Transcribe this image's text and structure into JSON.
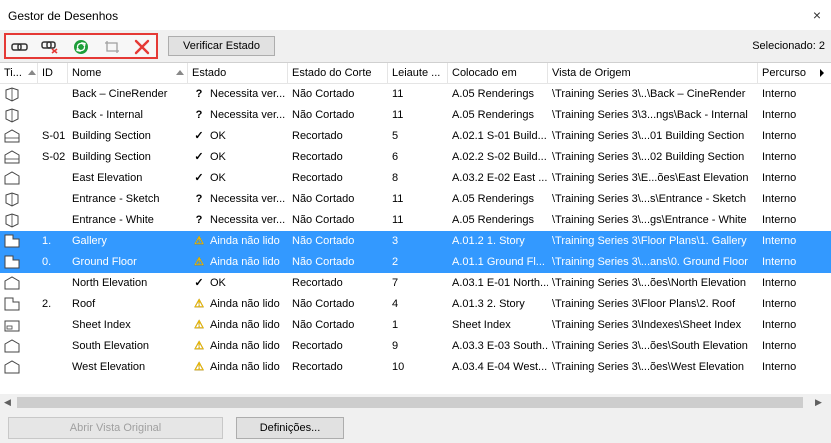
{
  "window": {
    "title": "Gestor de Desenhos",
    "close_glyph": "×"
  },
  "toolbar": {
    "verify_label": "Verificar Estado",
    "selected_label": "Selecionado: 2"
  },
  "columns": {
    "type": "Ti...",
    "id": "ID",
    "name": "Nome",
    "status": "Estado",
    "cut_state": "Estado do Corte",
    "layout": "Leiaute ...",
    "placed_in": "Colocado em",
    "source_view": "Vista de Origem",
    "path": "Percurso"
  },
  "rows": [
    {
      "icon": "shield-drawing-icon",
      "id": "",
      "name": "Back – CineRender",
      "status_icon": "?",
      "status": "Necessita ver...",
      "cut": "Não Cortado",
      "layout": "11",
      "placed": "A.05 Renderings",
      "source": "\\Training Series 3\\..\\Back – CineRender",
      "path": "Interno",
      "selected": false
    },
    {
      "icon": "shield-drawing-icon",
      "id": "",
      "name": "Back - Internal",
      "status_icon": "?",
      "status": "Necessita ver...",
      "cut": "Não Cortado",
      "layout": "11",
      "placed": "A.05 Renderings",
      "source": "\\Training Series 3\\3...ngs\\Back - Internal",
      "path": "Interno",
      "selected": false
    },
    {
      "icon": "section-drawing-icon",
      "id": "S-01",
      "name": "Building Section",
      "status_icon": "✓",
      "status": "OK",
      "cut": "Recortado",
      "layout": "5",
      "placed": "A.02.1 S-01 Build...",
      "source": "\\Training Series 3\\...01 Building Section",
      "path": "Interno",
      "selected": false
    },
    {
      "icon": "section-drawing-icon",
      "id": "S-02",
      "name": "Building Section",
      "status_icon": "✓",
      "status": "OK",
      "cut": "Recortado",
      "layout": "6",
      "placed": "A.02.2 S-02 Build...",
      "source": "\\Training Series 3\\...02 Building Section",
      "path": "Interno",
      "selected": false
    },
    {
      "icon": "elevation-drawing-icon",
      "id": "",
      "name": "East Elevation",
      "status_icon": "✓",
      "status": "OK",
      "cut": "Recortado",
      "layout": "8",
      "placed": "A.03.2 E-02 East ...",
      "source": "\\Training Series 3\\E...ões\\East Elevation",
      "path": "Interno",
      "selected": false
    },
    {
      "icon": "shield-drawing-icon",
      "id": "",
      "name": "Entrance - Sketch",
      "status_icon": "?",
      "status": "Necessita ver...",
      "cut": "Não Cortado",
      "layout": "11",
      "placed": "A.05 Renderings",
      "source": "\\Training Series 3\\...s\\Entrance - Sketch",
      "path": "Interno",
      "selected": false
    },
    {
      "icon": "shield-drawing-icon",
      "id": "",
      "name": "Entrance - White",
      "status_icon": "?",
      "status": "Necessita ver...",
      "cut": "Não Cortado",
      "layout": "11",
      "placed": "A.05 Renderings",
      "source": "\\Training Series 3\\...gs\\Entrance - White",
      "path": "Interno",
      "selected": false
    },
    {
      "icon": "floorplan-drawing-icon",
      "id": "1.",
      "name": "Gallery",
      "status_icon": "⚠",
      "status": "Ainda não lido",
      "cut": "Não Cortado",
      "layout": "3",
      "placed": "A.01.2 1. Story",
      "source": "\\Training Series 3\\Floor Plans\\1. Gallery",
      "path": "Interno",
      "selected": true
    },
    {
      "icon": "floorplan-drawing-icon",
      "id": "0.",
      "name": "Ground Floor",
      "status_icon": "⚠",
      "status": "Ainda não lido",
      "cut": "Não Cortado",
      "layout": "2",
      "placed": "A.01.1 Ground Fl...",
      "source": "\\Training Series 3\\...ans\\0. Ground Floor",
      "path": "Interno",
      "selected": true
    },
    {
      "icon": "elevation-drawing-icon",
      "id": "",
      "name": "North Elevation",
      "status_icon": "✓",
      "status": "OK",
      "cut": "Recortado",
      "layout": "7",
      "placed": "A.03.1 E-01 North...",
      "source": "\\Training Series 3\\...ões\\North Elevation",
      "path": "Interno",
      "selected": false
    },
    {
      "icon": "floorplan-drawing-icon",
      "id": "2.",
      "name": "Roof",
      "status_icon": "⚠",
      "status": "Ainda não lido",
      "cut": "Não Cortado",
      "layout": "4",
      "placed": "A.01.3 2. Story",
      "source": "\\Training Series 3\\Floor Plans\\2. Roof",
      "path": "Interno",
      "selected": false
    },
    {
      "icon": "index-drawing-icon",
      "id": "",
      "name": "Sheet Index",
      "status_icon": "⚠",
      "status": "Ainda não lido",
      "cut": "Não Cortado",
      "layout": "1",
      "placed": "Sheet Index",
      "source": "\\Training Series 3\\Indexes\\Sheet Index",
      "path": "Interno",
      "selected": false
    },
    {
      "icon": "elevation-drawing-icon",
      "id": "",
      "name": "South Elevation",
      "status_icon": "⚠",
      "status": "Ainda não lido",
      "cut": "Recortado",
      "layout": "9",
      "placed": "A.03.3 E-03 South...",
      "source": "\\Training Series 3\\...ões\\South Elevation",
      "path": "Interno",
      "selected": false
    },
    {
      "icon": "elevation-drawing-icon",
      "id": "",
      "name": "West Elevation",
      "status_icon": "⚠",
      "status": "Ainda não lido",
      "cut": "Recortado",
      "layout": "10",
      "placed": "A.03.4 E-04 West...",
      "source": "\\Training Series 3\\...ões\\West Elevation",
      "path": "Interno",
      "selected": false
    }
  ],
  "footer": {
    "open_original_label": "Abrir Vista Original",
    "settings_label": "Definições..."
  },
  "colors": {
    "selection": "#3399ff",
    "highlight_border": "#e53935",
    "delete_red": "#e53935",
    "update_green": "#1e9e3a",
    "warning_yellow": "#f6c000"
  }
}
